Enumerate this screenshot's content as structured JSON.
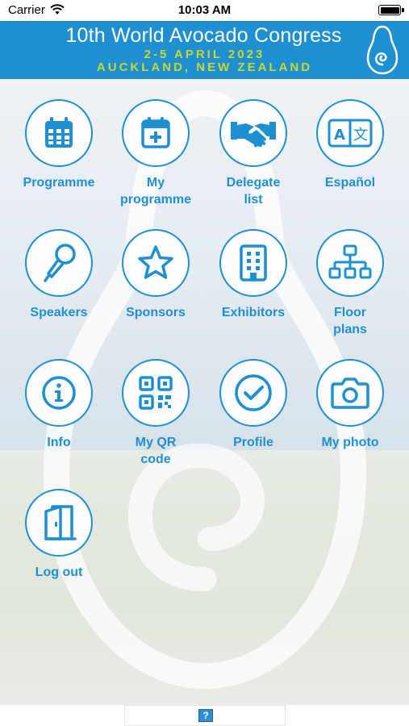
{
  "status_bar": {
    "carrier": "Carrier",
    "time": "10:03 AM"
  },
  "banner": {
    "title": "10th World Avocado Congress",
    "dates": "2-5 APRIL 2023",
    "location": "AUCKLAND, NEW ZEALAND",
    "title_color": "#ffffff",
    "accent_color": "#c9d82f",
    "background_color": "#1e8fd0"
  },
  "menu": {
    "items": [
      {
        "label": "Programme",
        "icon": "calendar-icon"
      },
      {
        "label": "My\nprogramme",
        "icon": "calendar-plus-icon"
      },
      {
        "label": "Delegate\nlist",
        "icon": "handshake-icon"
      },
      {
        "label": "Español",
        "icon": "translate-icon"
      },
      {
        "label": "Speakers",
        "icon": "microphone-icon"
      },
      {
        "label": "Sponsors",
        "icon": "star-icon"
      },
      {
        "label": "Exhibitors",
        "icon": "building-icon"
      },
      {
        "label": "Floor\nplans",
        "icon": "org-chart-icon"
      },
      {
        "label": "Info",
        "icon": "info-icon"
      },
      {
        "label": "My QR\ncode",
        "icon": "qr-code-icon"
      },
      {
        "label": "Profile",
        "icon": "check-circle-icon"
      },
      {
        "label": "My photo",
        "icon": "camera-icon"
      },
      {
        "label": "Log out",
        "icon": "door-open-icon"
      }
    ],
    "accent_color": "#1e8fd0"
  },
  "bottom_bar": {
    "help_label": "?"
  }
}
